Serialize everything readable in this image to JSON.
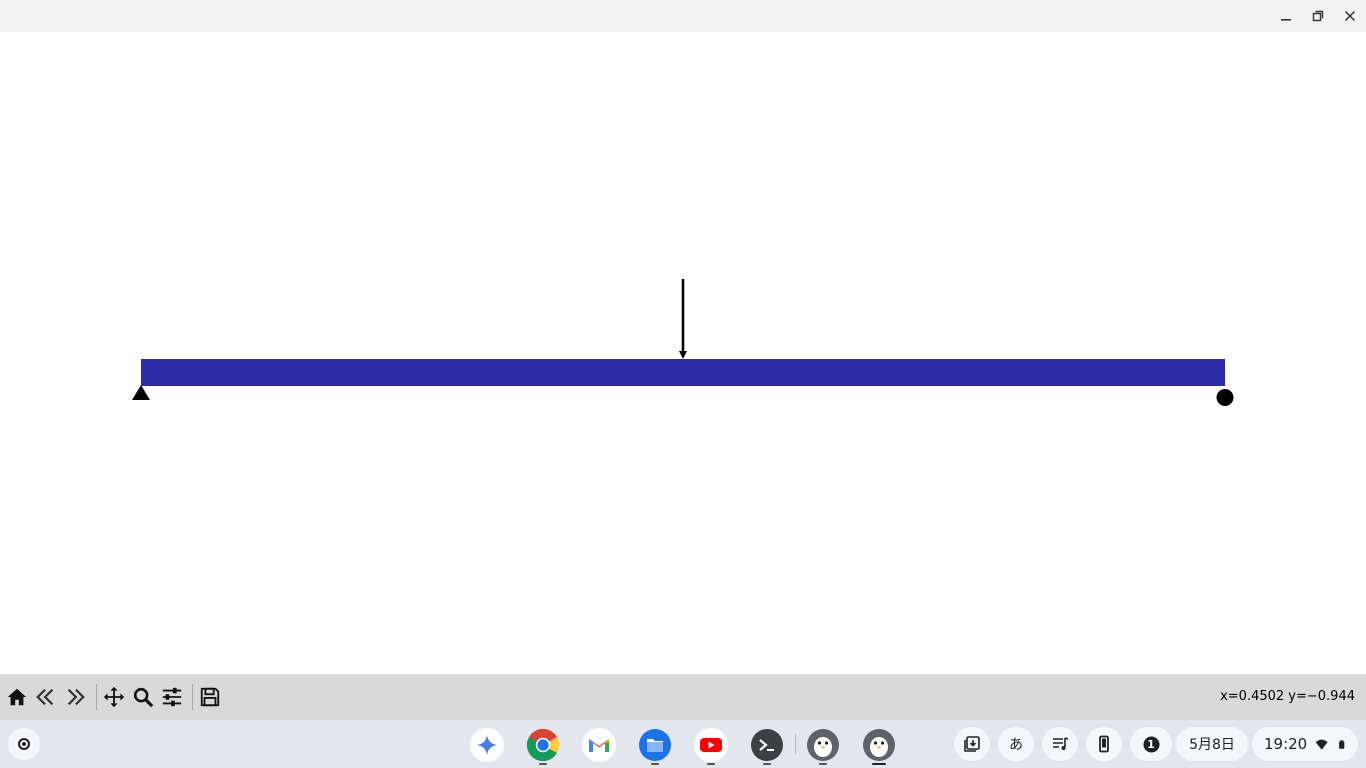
{
  "window": {
    "controls": [
      "minimize-icon",
      "restore-icon",
      "close-icon"
    ]
  },
  "figure": {
    "beam_color": "#2c2ca6",
    "load_color": "#000000",
    "supports": [
      "pin-support-triangle",
      "roller-support-circle"
    ]
  },
  "toolbar": {
    "buttons": [
      "home-icon",
      "back-icon",
      "forward-icon",
      "pan-icon",
      "zoom-icon",
      "configure-subplots-icon",
      "save-icon"
    ],
    "coords": "x=0.4502 y=−0.944"
  },
  "shelf": {
    "apps": [
      "gemini",
      "chrome",
      "gmail",
      "files",
      "youtube",
      "terminal",
      "linux-penguin",
      "linux-penguin"
    ],
    "tray": {
      "ime": "あ",
      "notification_count": "1",
      "date": "5月8日",
      "time": "19:20"
    }
  }
}
